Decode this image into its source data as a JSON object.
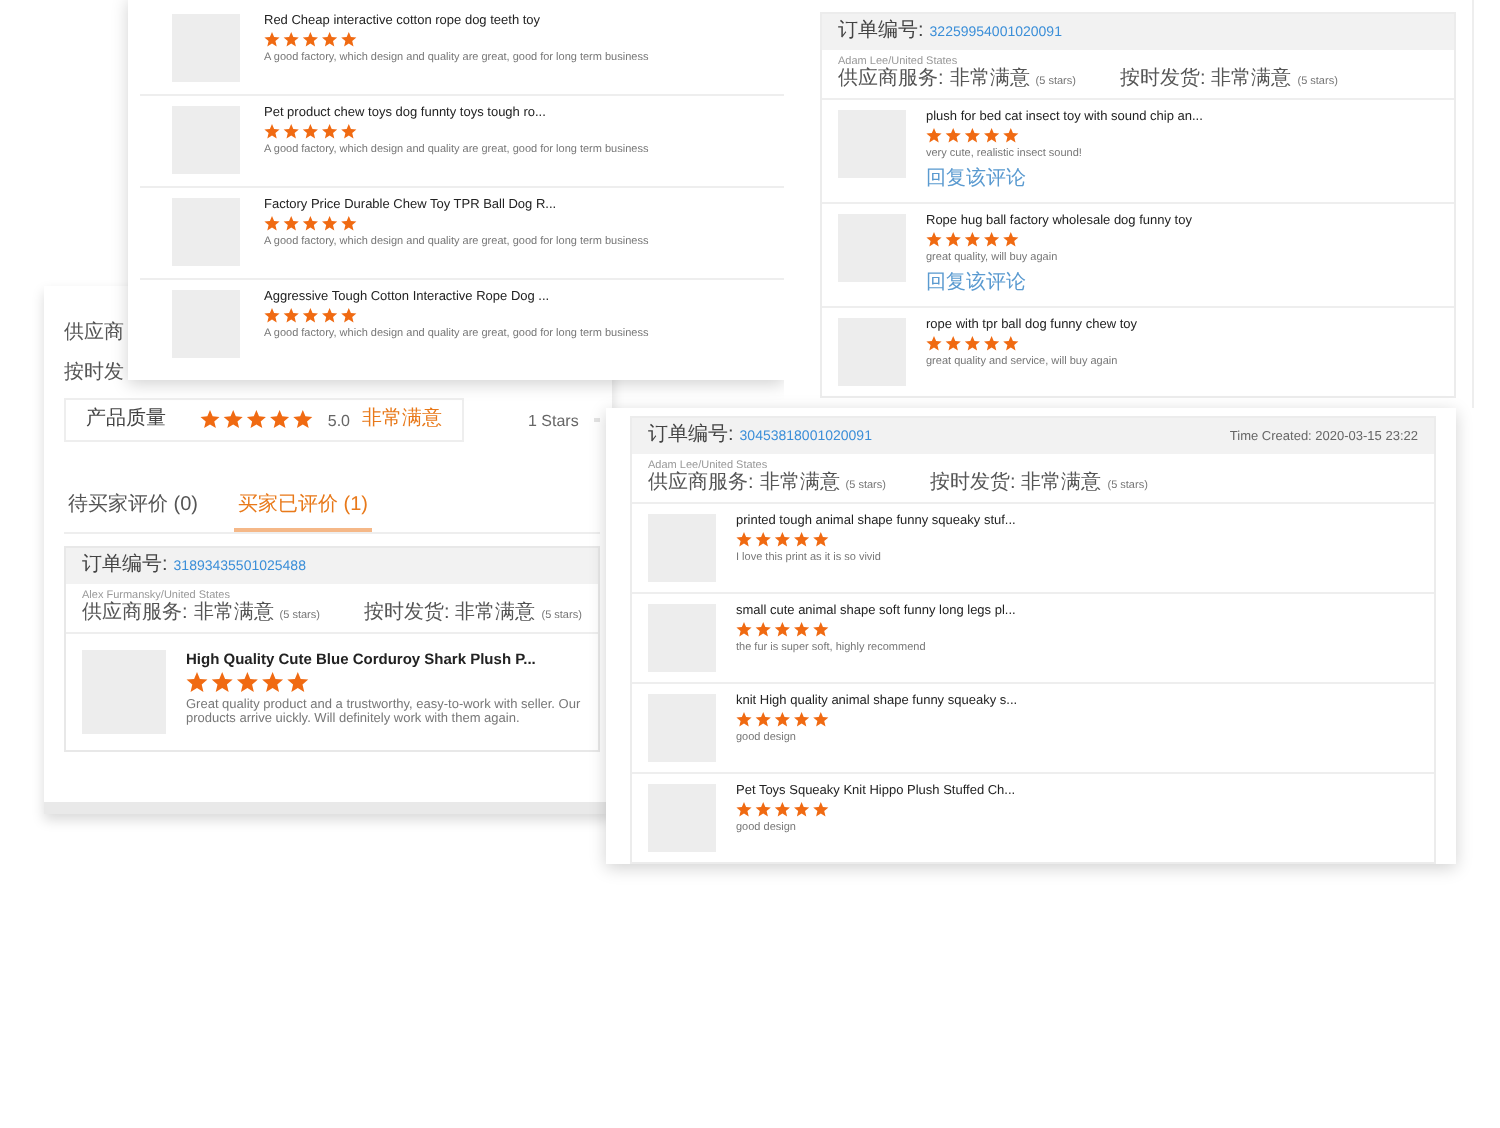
{
  "back_panel": {
    "partial_labels": [
      "供应商",
      "按时发"
    ],
    "quality": {
      "label": "产品质量",
      "stars": 5,
      "score": "5.0",
      "verdict": "非常满意"
    },
    "star_count_label": "1 Stars",
    "tabs": [
      {
        "label": "待买家评价 (0)",
        "selected": false
      },
      {
        "label": "买家已评价 (1)",
        "selected": true
      }
    ],
    "order": {
      "number_label": "订单编号:",
      "number": "31893435501025488",
      "buyer": "Alex Furmansky/United States",
      "ratings": [
        {
          "label": "供应商服务:",
          "value": "非常满意",
          "note": "(5 stars)"
        },
        {
          "label": "按时发货:",
          "value": "非常满意",
          "note": "(5 stars)"
        }
      ],
      "items": [
        {
          "title": "High Quality Cute Blue Corduroy Shark Plush P...",
          "stars": 5,
          "comment": "Great quality product and a trustworthy, easy-to-work with seller. Our products arrive uickly. Will definitely work with them again."
        }
      ]
    }
  },
  "product_reviews": [
    {
      "title": "Red Cheap interactive cotton rope dog teeth toy",
      "stars": 5,
      "comment": "A good factory, which design and quality are great, good for long term business"
    },
    {
      "title": "Pet product chew toys dog funnty toys tough ro...",
      "stars": 5,
      "comment": "A good factory, which design and quality are great, good for long term business"
    },
    {
      "title": "Factory Price Durable Chew Toy TPR Ball Dog R...",
      "stars": 5,
      "comment": "A good factory, which design and quality are great, good for long term business"
    },
    {
      "title": "Aggressive Tough Cotton Interactive Rope Dog ...",
      "stars": 5,
      "comment": "A good factory, which design and quality are great, good for long term business"
    }
  ],
  "orders": [
    {
      "number_label": "订单编号:",
      "number": "32259954001020091",
      "buyer": "Adam Lee/United States",
      "ratings": [
        {
          "label": "供应商服务:",
          "value": "非常满意",
          "note": "(5 stars)"
        },
        {
          "label": "按时发货:",
          "value": "非常满意",
          "note": "(5 stars)"
        }
      ],
      "items": [
        {
          "title": "plush for bed cat insect toy with sound chip an...",
          "stars": 5,
          "comment": "very cute, realistic insect sound!",
          "reply_link": "回复该评论"
        },
        {
          "title": "Rope hug ball factory wholesale dog funny toy",
          "stars": 5,
          "comment": "great quality, will buy again",
          "reply_link": "回复该评论"
        },
        {
          "title": "rope with tpr ball dog funny chew toy",
          "stars": 5,
          "comment": "great quality and service, will buy again"
        }
      ]
    },
    {
      "number_label": "订单编号:",
      "number": "30453818001020091",
      "time_created": "Time Created: 2020-03-15 23:22",
      "buyer": "Adam Lee/United States",
      "ratings": [
        {
          "label": "供应商服务:",
          "value": "非常满意",
          "note": "(5 stars)"
        },
        {
          "label": "按时发货:",
          "value": "非常满意",
          "note": "(5 stars)"
        }
      ],
      "items": [
        {
          "title": "printed tough animal shape funny squeaky stuf...",
          "stars": 5,
          "comment": "I love this print as it is so vivid"
        },
        {
          "title": "small cute animal shape soft funny long legs pl...",
          "stars": 5,
          "comment": "the fur is super soft, highly recommend"
        },
        {
          "title": "knit High quality animal shape funny squeaky s...",
          "stars": 5,
          "comment": "good design"
        },
        {
          "title": "Pet Toys Squeaky Knit Hippo Plush Stuffed Ch...",
          "stars": 5,
          "comment": "good design"
        }
      ]
    }
  ]
}
